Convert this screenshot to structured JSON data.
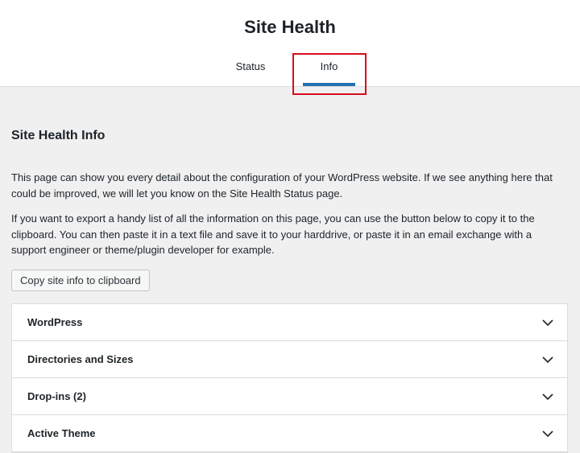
{
  "header": {
    "title": "Site Health",
    "tabs": [
      {
        "label": "Status",
        "active": false
      },
      {
        "label": "Info",
        "active": true
      }
    ]
  },
  "main": {
    "section_title": "Site Health Info",
    "paragraphs": [
      "This page can show you every detail about the configuration of your WordPress website. If we see anything here that could be improved, we will let you know on the Site Health Status page.",
      "If you want to export a handy list of all the information on this page, you can use the button below to copy it to the clipboard. You can then paste it in a text file and save it to your harddrive, or paste it in an email exchange with a support engineer or theme/plugin developer for example."
    ],
    "copy_button_label": "Copy site info to clipboard",
    "accordion": [
      {
        "label": "WordPress",
        "icon": "chevron-down-icon"
      },
      {
        "label": "Directories and Sizes",
        "icon": "chevron-down-icon"
      },
      {
        "label": "Drop-ins (2)",
        "icon": "chevron-down-icon"
      },
      {
        "label": "Active Theme",
        "icon": "chevron-down-icon"
      }
    ]
  },
  "colors": {
    "accent": "#2271b1",
    "highlight": "#d60c1d",
    "background": "#f0f0f1",
    "text": "#1d2327"
  }
}
